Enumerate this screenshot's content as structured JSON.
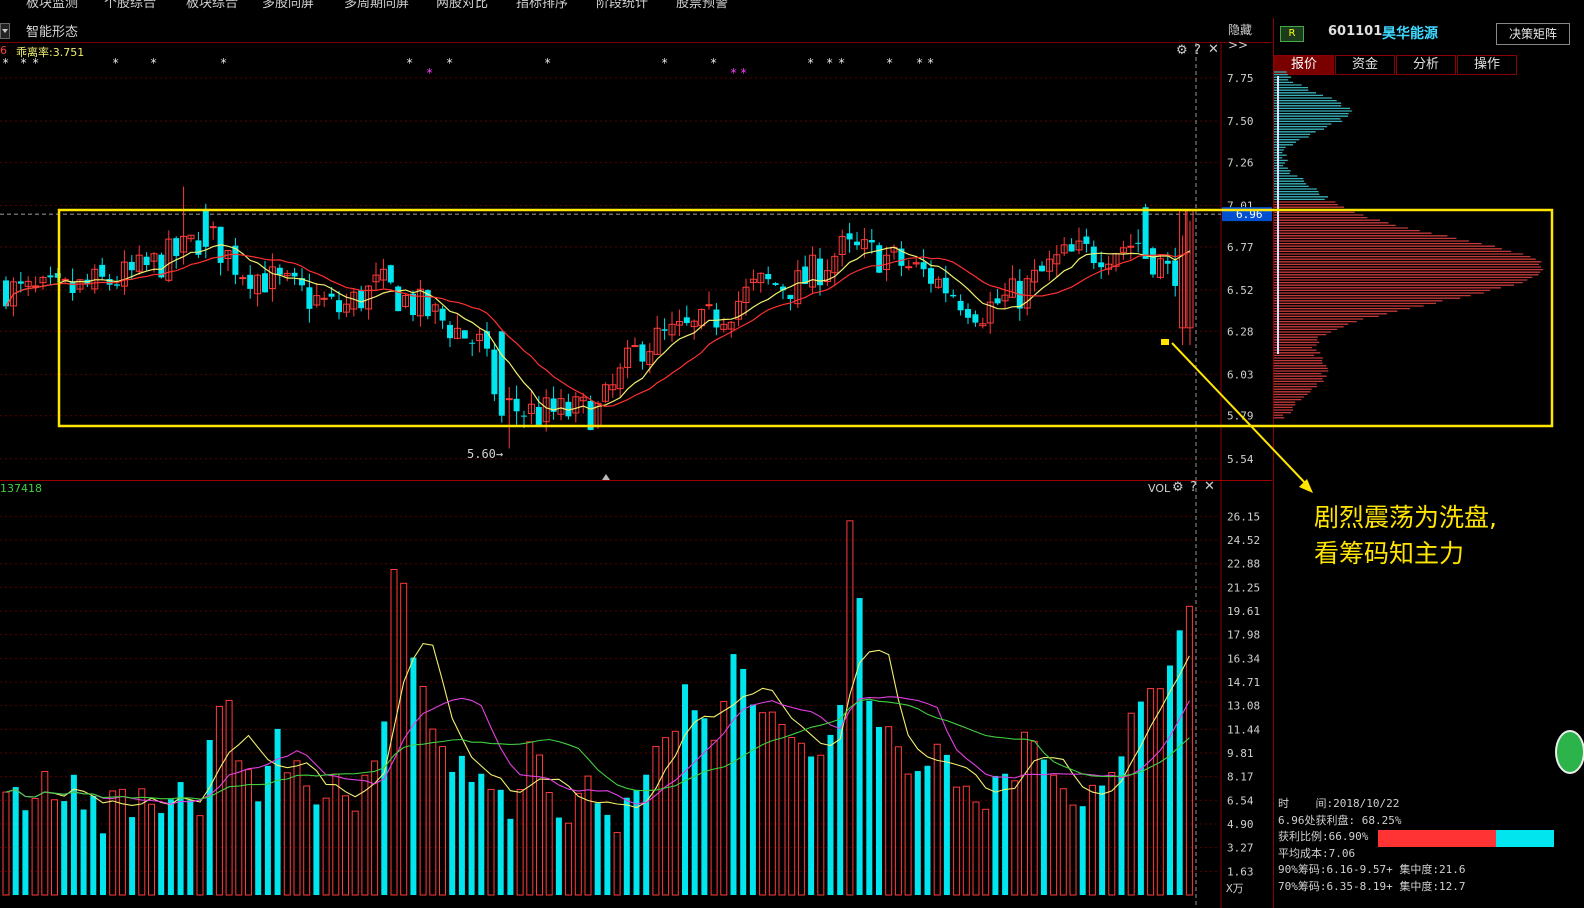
{
  "menu": {
    "items": [
      "板块监测",
      "个股综合",
      "板块综合",
      "多股同屏",
      "多周期同屏",
      "两股对比",
      "指标排序",
      "阶段统计",
      "股票预警"
    ]
  },
  "tabbar": {
    "label": "智能形态",
    "hide_label": "隐藏>>"
  },
  "price": {
    "indicator_left": "6",
    "indicator_label": "乖离率:3.751",
    "price_axis": [
      "7.75",
      "7.50",
      "7.26",
      "7.01",
      "6.77",
      "6.52",
      "6.28",
      "6.03",
      "5.79",
      "5.54"
    ],
    "current_price": "6.96",
    "low_label": "5.60→"
  },
  "volume": {
    "indicator_left": "137418",
    "label": "VOL",
    "axis": [
      "26.15",
      "24.52",
      "22.88",
      "21.25",
      "19.61",
      "17.98",
      "16.34",
      "14.71",
      "13.08",
      "11.44",
      "9.81",
      "8.17",
      "6.54",
      "4.90",
      "3.27",
      "1.63"
    ],
    "unit": "X万"
  },
  "right": {
    "badge": "R",
    "code": "601101",
    "name": "昊华能源",
    "matrix": "决策矩阵",
    "tabs": [
      "报价",
      "资金",
      "分析",
      "操作"
    ],
    "chip_lines": [
      "时    间:2018/10/22",
      "6.96处获利盘: 68.25%",
      "获利比例:66.90%",
      "平均成本:7.06",
      "90%筹码:6.16-9.57+ 集中度:21.6",
      "70%筹码:6.35-8.19+ 集中度:12.7"
    ]
  },
  "annotation": {
    "text": "剧烈震荡为洗盘,\n看筹码知主力"
  },
  "colors": {
    "up": "#ff3a3a",
    "down": "#00e5ee",
    "ma5": "#f0f070",
    "ma10": "#ff3030",
    "vma1": "#f0f070",
    "vma2": "#e040e0",
    "vma3": "#40d040",
    "box": "#ffe500"
  }
}
